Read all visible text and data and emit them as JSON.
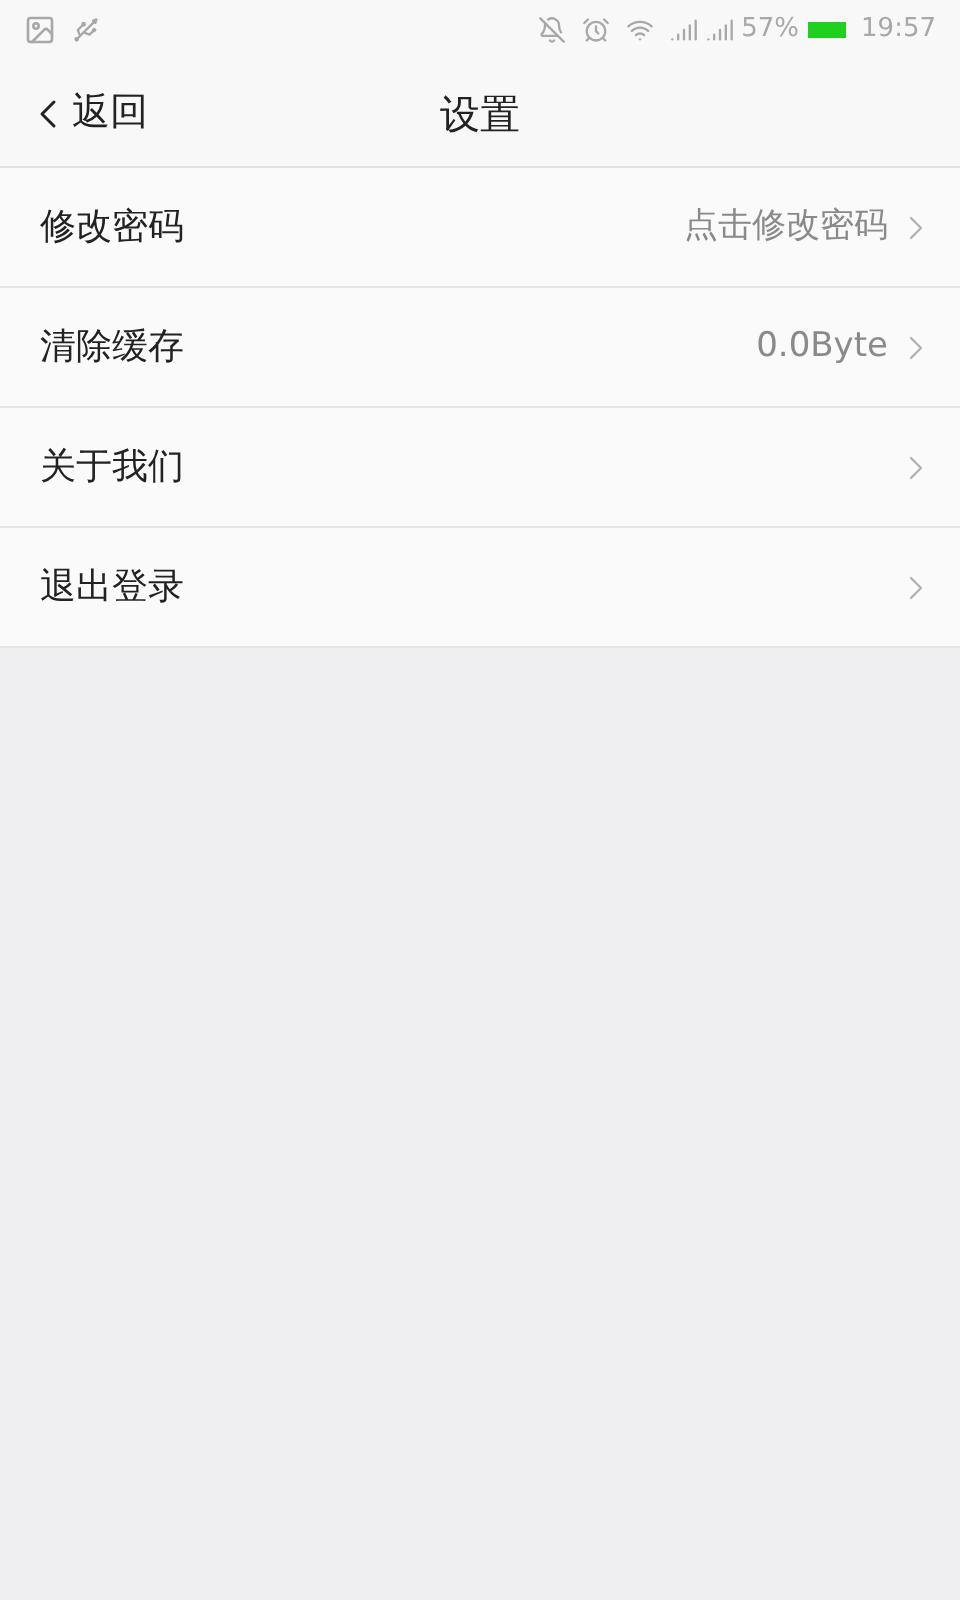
{
  "status_bar": {
    "battery": "57%",
    "time": "19:57"
  },
  "nav": {
    "back": "返回",
    "title": "设置"
  },
  "rows": [
    {
      "label": "修改密码",
      "value": "点击修改密码"
    },
    {
      "label": "清除缓存",
      "value": "0.0Byte"
    },
    {
      "label": "关于我们"
    },
    {
      "label": "退出登录"
    }
  ]
}
